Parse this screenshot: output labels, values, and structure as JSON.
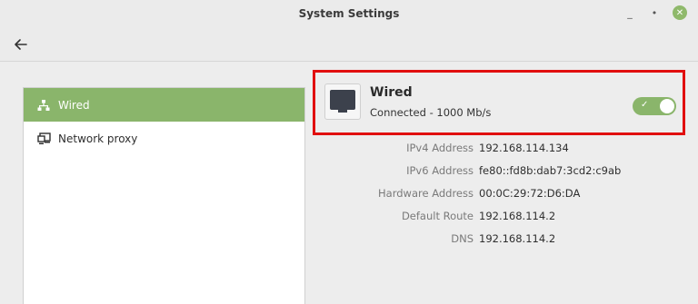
{
  "window": {
    "title": "System Settings",
    "minimize_glyph": "_",
    "maximize_glyph": "•",
    "close_glyph": "✕"
  },
  "header": {
    "back_icon": "back-arrow-icon"
  },
  "sidebar": {
    "items": [
      {
        "label": "Wired",
        "icon": "network-wired-icon",
        "active": true
      },
      {
        "label": "Network proxy",
        "icon": "network-proxy-icon",
        "active": false
      }
    ]
  },
  "device": {
    "name": "Wired",
    "status": "Connected - 1000 Mb/s",
    "icon": "ethernet-port-icon",
    "enabled": true
  },
  "details": [
    {
      "label": "IPv4 Address",
      "value": "192.168.114.134"
    },
    {
      "label": "IPv6 Address",
      "value": "fe80::fd8b:dab7:3cd2:c9ab"
    },
    {
      "label": "Hardware Address",
      "value": "00:0C:29:72:D6:DA"
    },
    {
      "label": "Default Route",
      "value": "192.168.114.2"
    },
    {
      "label": "DNS",
      "value": "192.168.114.2"
    }
  ],
  "colors": {
    "accent": "#8ab56b",
    "highlight_border": "#e10f0f"
  }
}
